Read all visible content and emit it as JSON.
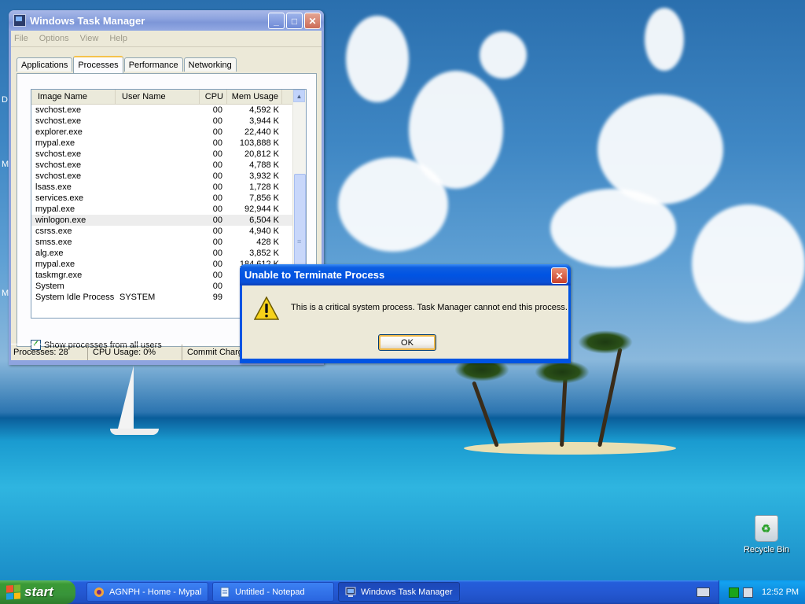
{
  "task_manager": {
    "title": "Windows Task Manager",
    "menu": [
      "File",
      "Options",
      "View",
      "Help"
    ],
    "tabs": [
      "Applications",
      "Processes",
      "Performance",
      "Networking"
    ],
    "columns": {
      "image_name": "Image Name",
      "user_name": "User Name",
      "cpu": "CPU",
      "mem_usage": "Mem Usage"
    },
    "processes": [
      {
        "name": "svchost.exe",
        "user": "",
        "cpu": "00",
        "mem": "4,592 K"
      },
      {
        "name": "svchost.exe",
        "user": "",
        "cpu": "00",
        "mem": "3,944 K"
      },
      {
        "name": "explorer.exe",
        "user": "",
        "cpu": "00",
        "mem": "22,440 K"
      },
      {
        "name": "mypal.exe",
        "user": "",
        "cpu": "00",
        "mem": "103,888 K"
      },
      {
        "name": "svchost.exe",
        "user": "",
        "cpu": "00",
        "mem": "20,812 K"
      },
      {
        "name": "svchost.exe",
        "user": "",
        "cpu": "00",
        "mem": "4,788 K"
      },
      {
        "name": "svchost.exe",
        "user": "",
        "cpu": "00",
        "mem": "3,932 K"
      },
      {
        "name": "lsass.exe",
        "user": "",
        "cpu": "00",
        "mem": "1,728 K"
      },
      {
        "name": "services.exe",
        "user": "",
        "cpu": "00",
        "mem": "7,856 K"
      },
      {
        "name": "mypal.exe",
        "user": "",
        "cpu": "00",
        "mem": "92,944 K"
      },
      {
        "name": "winlogon.exe",
        "user": "",
        "cpu": "00",
        "mem": "6,504 K"
      },
      {
        "name": "csrss.exe",
        "user": "",
        "cpu": "00",
        "mem": "4,940 K"
      },
      {
        "name": "smss.exe",
        "user": "",
        "cpu": "00",
        "mem": "428 K"
      },
      {
        "name": "alg.exe",
        "user": "",
        "cpu": "00",
        "mem": "3,852 K"
      },
      {
        "name": "mypal.exe",
        "user": "",
        "cpu": "00",
        "mem": "184,612 K"
      },
      {
        "name": "taskmgr.exe",
        "user": "",
        "cpu": "00",
        "mem": ""
      },
      {
        "name": "System",
        "user": "",
        "cpu": "00",
        "mem": ""
      },
      {
        "name": "System Idle Process",
        "user": "SYSTEM",
        "cpu": "99",
        "mem": ""
      }
    ],
    "show_all_label": "Show processes from all users",
    "show_all_checked": true,
    "status": {
      "processes": "Processes: 28",
      "cpu": "CPU Usage: 0%",
      "commit": "Commit Charge"
    }
  },
  "dialog": {
    "title": "Unable to Terminate Process",
    "message": "This is a critical system process.  Task Manager cannot end this process.",
    "ok_label": "OK",
    "icon": "warning-icon"
  },
  "desktop": {
    "recycle_bin_label": "Recycle Bin",
    "edge_letters": [
      "D",
      "M",
      "M"
    ]
  },
  "taskbar": {
    "start_label": "start",
    "buttons": [
      {
        "label": "AGNPH - Home - Mypal",
        "icon": "mypal-icon"
      },
      {
        "label": "Untitled - Notepad",
        "icon": "notepad-icon"
      },
      {
        "label": "Windows Task Manager",
        "icon": "taskmgr-icon"
      }
    ],
    "clock": "12:52 PM"
  }
}
